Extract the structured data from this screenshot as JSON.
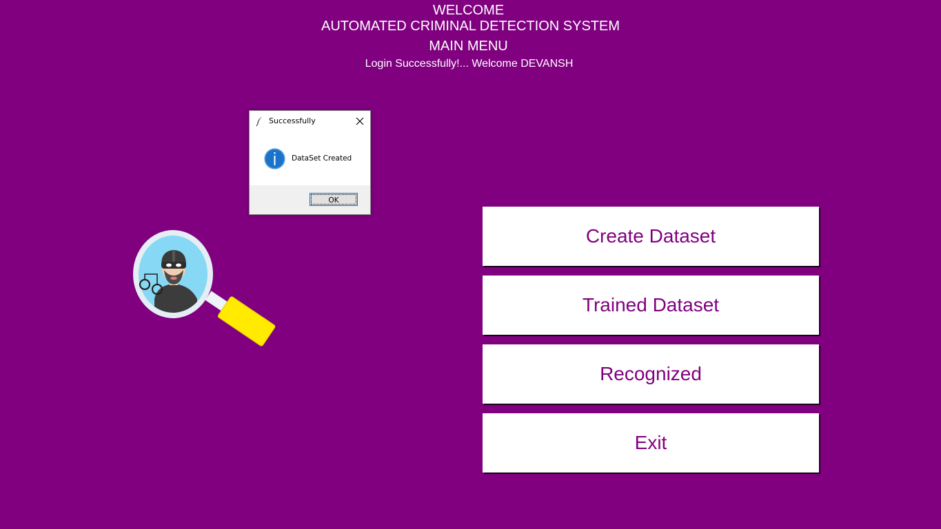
{
  "header": {
    "welcome": "WELCOME",
    "system_title": "AUTOMATED CRIMINAL DETECTION SYSTEM",
    "menu_title": "MAIN MENU",
    "login_message": "Login Successfully!... Welcome DEVANSH"
  },
  "menu": {
    "create_dataset": "Create Dataset",
    "trained_dataset": "Trained Dataset",
    "recognized": "Recognized",
    "exit": "Exit"
  },
  "dialog": {
    "title": "Successfully",
    "message": "DataSet Created",
    "ok_label": "OK",
    "icons": [
      "feather-icon",
      "close-icon",
      "info-icon"
    ]
  },
  "logo": {
    "icon": "criminal-magnifier-icon"
  },
  "colors": {
    "background": "#800080",
    "button_text": "#800080",
    "button_bg": "#ffffff",
    "header_text": "#ffffff"
  }
}
